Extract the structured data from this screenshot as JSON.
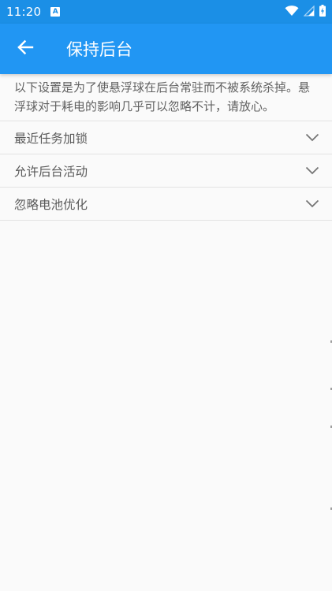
{
  "status_bar": {
    "time": "11:20",
    "app_icon_letter": "A",
    "icons": [
      "wifi-icon",
      "signal-icon",
      "battery-charging-icon"
    ]
  },
  "app_bar": {
    "back_icon": "arrow-left-icon",
    "title": "保持后台"
  },
  "description": "以下设置是为了使悬浮球在后台常驻而不被系统杀掉。悬浮球对于耗电的影响几乎可以忽略不计，请放心。",
  "items": [
    {
      "label": "最近任务加锁",
      "icon": "chevron-down-icon"
    },
    {
      "label": "允许后台活动",
      "icon": "chevron-down-icon"
    },
    {
      "label": "忽略电池优化",
      "icon": "chevron-down-icon"
    }
  ],
  "colors": {
    "status_bar": "#1b8fe6",
    "app_bar": "#2196f3",
    "background": "#fafafa",
    "text": "#616161",
    "divider": "#e3e3e3"
  }
}
